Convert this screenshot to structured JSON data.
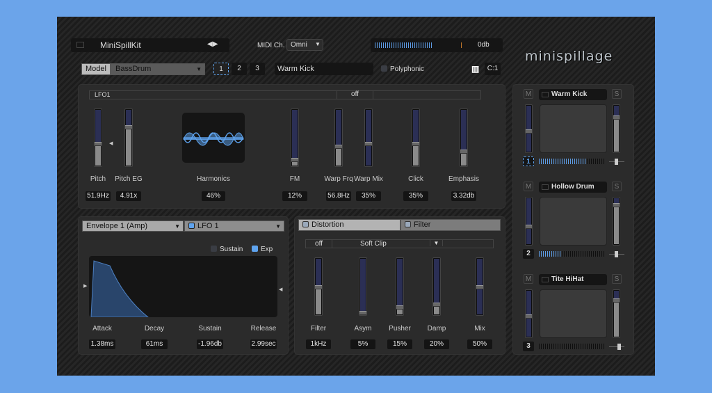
{
  "header": {
    "preset_name": "MiniSpillKit",
    "midi_label": "MIDI Ch.",
    "midi_value": "Omni",
    "output_level": "0db",
    "output_meter": 0.7,
    "logo": "minispillage"
  },
  "voice": {
    "model_label": "Model",
    "model_value": "BassDrum",
    "voice_buttons": [
      "1",
      "2",
      "3"
    ],
    "selected_voice": "1",
    "voice_name": "Warm Kick",
    "polyphonic_label": "Polyphonic",
    "polyphonic": false,
    "key_label": "C:1"
  },
  "oscillator": {
    "mod_source": "LFO1",
    "mod_amount": "off",
    "params": [
      {
        "label": "Pitch",
        "value": "51.9Hz",
        "level": 0.4
      },
      {
        "label": "Pitch EG",
        "value": "4.91x",
        "level": 0.7
      },
      {
        "label": "FM",
        "value": "12%",
        "level": 0.12
      },
      {
        "label": "Warp Frq",
        "value": "56.8Hz",
        "level": 0.35
      },
      {
        "label": "Warp Mix",
        "value": "35%",
        "level": 0.4,
        "bipolar": true
      },
      {
        "label": "Click",
        "value": "35%",
        "level": 0.4
      },
      {
        "label": "Emphasis",
        "value": "3.32db",
        "level": 0.27
      }
    ],
    "harmonics": {
      "label": "Harmonics",
      "value": "46%"
    }
  },
  "envelope": {
    "select": "Envelope 1 (Amp)",
    "target": "LFO 1",
    "sustain_label": "Sustain",
    "sustain": false,
    "exp_label": "Exp",
    "exp": true,
    "params": [
      {
        "label": "Attack",
        "value": "1.38ms"
      },
      {
        "label": "Decay",
        "value": "61ms"
      },
      {
        "label": "Sustain",
        "value": "-1.96db"
      },
      {
        "label": "Release",
        "value": "2.99sec"
      }
    ]
  },
  "effects": {
    "tabs": [
      "Distortion",
      "Filter"
    ],
    "active_tab": "Distortion",
    "mod_amount": "off",
    "type": "Soft Clip",
    "params": [
      {
        "label": "Filter",
        "value": "1kHz",
        "level": 0.5
      },
      {
        "label": "Asym",
        "value": "5%",
        "level": 0.05
      },
      {
        "label": "Pusher",
        "value": "15%",
        "level": 0.15
      },
      {
        "label": "Damp",
        "value": "20%",
        "level": 0.2
      },
      {
        "label": "Mix",
        "value": "50%",
        "level": 0.5,
        "bipolar": true
      }
    ]
  },
  "channels": [
    {
      "number": "1",
      "name": "Warm Kick",
      "mute": "M",
      "solo": "S",
      "level": 0.45,
      "send": 0.75,
      "meter": 0.7,
      "pan": 0.5,
      "selected": true
    },
    {
      "number": "2",
      "name": "Hollow Drum",
      "mute": "M",
      "solo": "S",
      "level": 0.4,
      "send": 0.85,
      "meter": 0.35,
      "pan": 0.5
    },
    {
      "number": "3",
      "name": "Tite HiHat",
      "mute": "M",
      "solo": "S",
      "level": 0.45,
      "send": 0.8,
      "meter": 0.0,
      "pan": 0.7
    }
  ],
  "colors": {
    "accent": "#5ea3ee",
    "background": "#6ba4ea"
  }
}
